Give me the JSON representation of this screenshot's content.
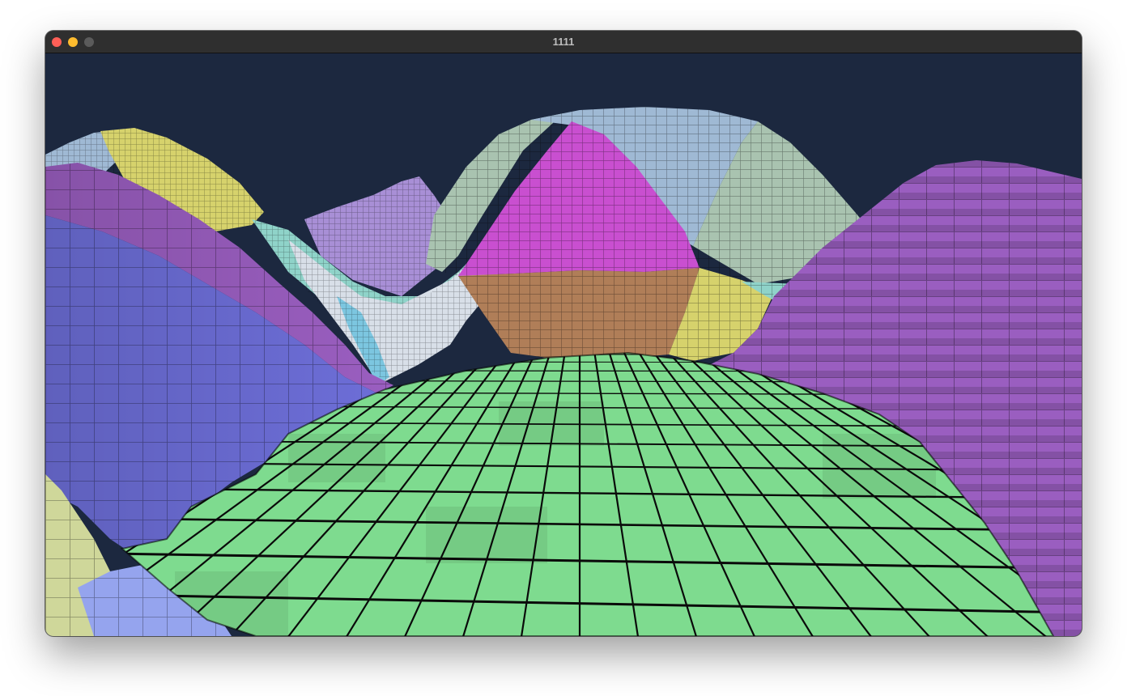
{
  "window": {
    "title": "1111",
    "controls": {
      "close_color": "#ff5f57",
      "minimize_color": "#febc2e",
      "zoom_color": "#5b5b5b"
    }
  },
  "scene": {
    "background_color": "#1c283f",
    "grid_line_color": "#0a0a0a",
    "region_colors": {
      "green": "#7edb8f",
      "blue_purple": "#6d6ed8",
      "purple": "#9a5ec0",
      "magenta": "#c94fd0",
      "brown": "#b07e58",
      "yellow": "#d6d26c",
      "light_blue": "#9fb9d4",
      "sage": "#a9c3b0",
      "teal": "#8fd3c9",
      "white": "#d8dfe8",
      "lilac": "#a88fd6",
      "pale_yellow": "#cfd79a",
      "periwinkle": "#95a4ee",
      "cyan": "#7cc6e0"
    }
  }
}
